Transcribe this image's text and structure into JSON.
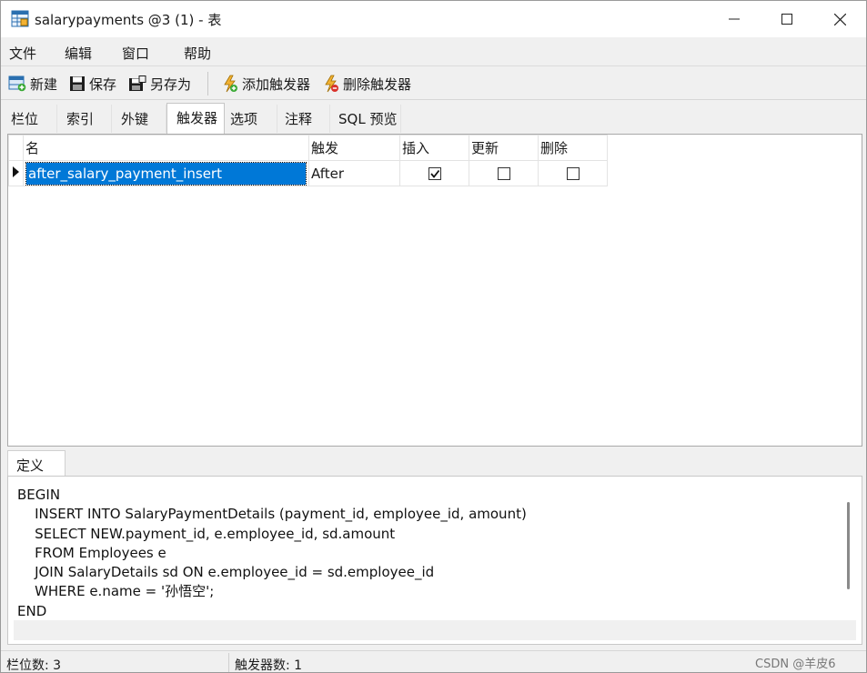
{
  "window": {
    "title": "salarypayments @3 (1) - 表"
  },
  "menu": {
    "items": [
      "文件",
      "编辑",
      "窗口",
      "帮助"
    ]
  },
  "toolbar": {
    "new_label": "新建",
    "save_label": "保存",
    "save_as_label": "另存为",
    "add_trigger_label": "添加触发器",
    "delete_trigger_label": "删除触发器"
  },
  "tabs": {
    "items": [
      "栏位",
      "索引",
      "外键",
      "触发器",
      "选项",
      "注释",
      "SQL 预览"
    ],
    "active": "触发器"
  },
  "grid": {
    "columns": [
      "名",
      "触发",
      "插入",
      "更新",
      "删除"
    ],
    "rows": [
      {
        "name": "after_salary_payment_insert",
        "timing": "After",
        "insert": true,
        "update": false,
        "delete": false
      }
    ]
  },
  "definition": {
    "tab_label": "定义",
    "code": "BEGIN\n    INSERT INTO SalaryPaymentDetails (payment_id, employee_id, amount)\n    SELECT NEW.payment_id, e.employee_id, sd.amount\n    FROM Employees e\n    JOIN SalaryDetails sd ON e.employee_id = sd.employee_id\n    WHERE e.name = '孙悟空';\nEND"
  },
  "status": {
    "field_count": "栏位数: 3",
    "trigger_count": "触发器数: 1"
  },
  "watermark": "CSDN @羊皮6",
  "colors": {
    "selection": "#0078d7",
    "window_bg": "#f0f0f0"
  }
}
